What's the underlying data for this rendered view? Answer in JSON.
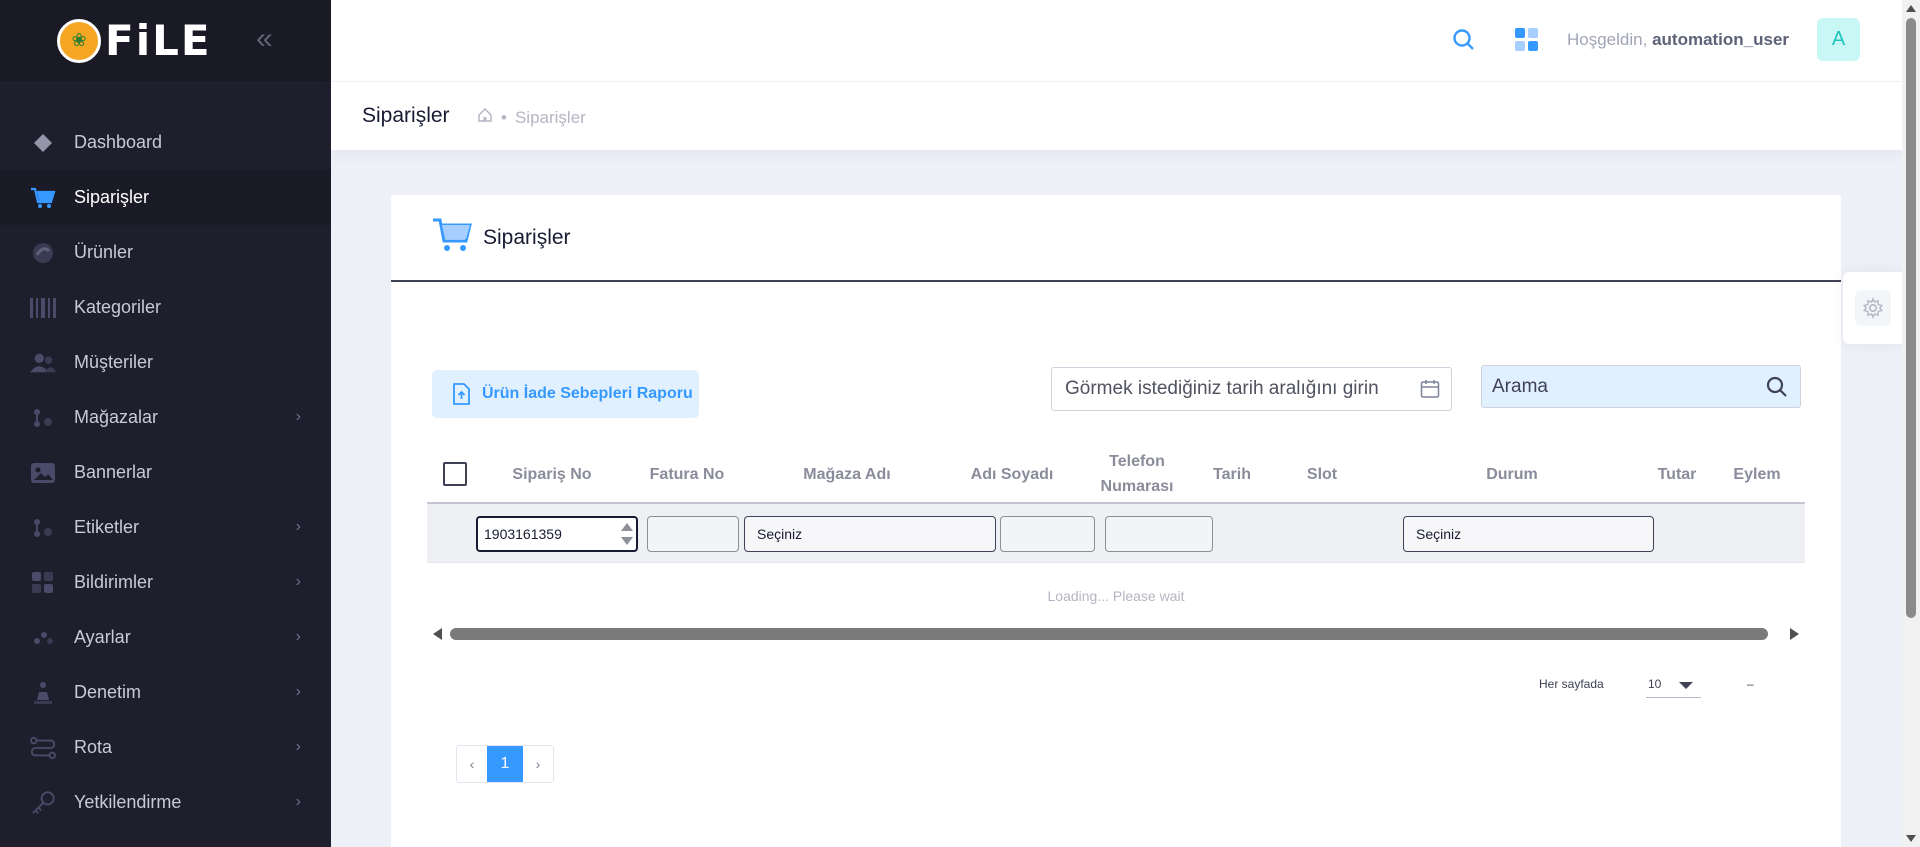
{
  "brand": {
    "logo_text": "FiLE"
  },
  "sidebar": {
    "items": [
      {
        "label": "Dashboard",
        "icon": "diamond-icon",
        "has_submenu": false
      },
      {
        "label": "Siparişler",
        "icon": "cart-icon",
        "has_submenu": false,
        "active": true
      },
      {
        "label": "Ürünler",
        "icon": "product-icon",
        "has_submenu": false
      },
      {
        "label": "Kategoriler",
        "icon": "barcode-icon",
        "has_submenu": false
      },
      {
        "label": "Müşteriler",
        "icon": "users-icon",
        "has_submenu": false
      },
      {
        "label": "Mağazalar",
        "icon": "store-icon",
        "has_submenu": true
      },
      {
        "label": "Bannerlar",
        "icon": "image-icon",
        "has_submenu": false
      },
      {
        "label": "Etiketler",
        "icon": "tag-icon",
        "has_submenu": true
      },
      {
        "label": "Bildirimler",
        "icon": "notification-icon",
        "has_submenu": true
      },
      {
        "label": "Ayarlar",
        "icon": "settings-icon",
        "has_submenu": true
      },
      {
        "label": "Denetim",
        "icon": "audit-icon",
        "has_submenu": true
      },
      {
        "label": "Rota",
        "icon": "route-icon",
        "has_submenu": true
      },
      {
        "label": "Yetkilendirme",
        "icon": "key-icon",
        "has_submenu": true
      }
    ]
  },
  "header": {
    "welcome_prefix": "Hoşgeldin,",
    "username": "automation_user",
    "avatar_letter": "A"
  },
  "subheader": {
    "title": "Siparişler",
    "breadcrumb_current": "Siparişler"
  },
  "card": {
    "title": "Siparişler",
    "report_button": "Ürün İade Sebepleri Raporu",
    "date_placeholder": "Görmek istediğiniz tarih aralığını girin",
    "search_placeholder": "Arama"
  },
  "table": {
    "columns": {
      "siparis_no": "Sipariş No",
      "fatura_no": "Fatura No",
      "magaza_adi": "Mağaza Adı",
      "adi_soyadi": "Adı Soyadı",
      "telefon_1": "Telefon",
      "telefon_2": "Numarası",
      "tarih": "Tarih",
      "slot": "Slot",
      "durum": "Durum",
      "tutar": "Tutar",
      "eylem": "Eylem"
    },
    "filters": {
      "siparis_no_value": "1903161359",
      "magaza_select": "Seçiniz",
      "durum_select": "Seçiniz"
    },
    "loading_text": "Loading... Please wait"
  },
  "pagination": {
    "per_page_label": "Her sayfada",
    "per_page_value": "10",
    "range_text": "–",
    "prev": "‹",
    "current_page": "1",
    "next": "›"
  },
  "colors": {
    "sidebar_bg": "#1e1e2d",
    "primary": "#3699ff",
    "primary_light": "#e1f0ff",
    "page_bg": "#eef0f8"
  }
}
